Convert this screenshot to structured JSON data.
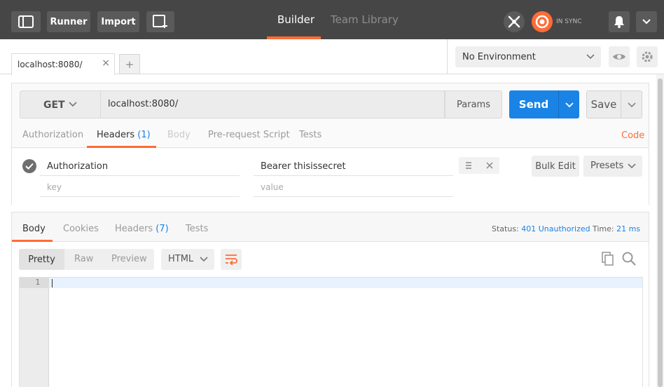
{
  "topbar": {
    "runner_label": "Runner",
    "import_label": "Import",
    "nav_builder": "Builder",
    "nav_team_library": "Team Library",
    "sync_status": "IN SYNC",
    "accent_color": "#ff6c37"
  },
  "tabs": {
    "items": [
      {
        "label": "localhost:8080/"
      }
    ],
    "close_glyph": "×",
    "add_glyph": "+"
  },
  "environment": {
    "selected": "No Environment"
  },
  "request": {
    "method": "GET",
    "url": "localhost:8080/",
    "params_label": "Params",
    "send_label": "Send",
    "save_label": "Save",
    "send_color": "#1a83e6"
  },
  "request_tabs": {
    "authorization": "Authorization",
    "headers": "Headers",
    "headers_count": "(1)",
    "body": "Body",
    "prerequest": "Pre-request Script",
    "tests": "Tests",
    "code_link": "Code"
  },
  "headers_table": {
    "rows": [
      {
        "key": "Authorization",
        "value": "Bearer thisissecret"
      }
    ],
    "key_placeholder": "key",
    "value_placeholder": "value",
    "bulk_edit_label": "Bulk Edit",
    "presets_label": "Presets"
  },
  "response": {
    "tabs": {
      "body": "Body",
      "cookies": "Cookies",
      "headers": "Headers",
      "headers_count": "(7)",
      "tests": "Tests"
    },
    "status_label": "Status:",
    "status_value": "401 Unauthorized",
    "time_label": "Time:",
    "time_value": "21 ms",
    "format": {
      "pretty": "Pretty",
      "raw": "Raw",
      "preview": "Preview",
      "language": "HTML"
    },
    "editor": {
      "line_numbers": [
        "1"
      ]
    }
  }
}
